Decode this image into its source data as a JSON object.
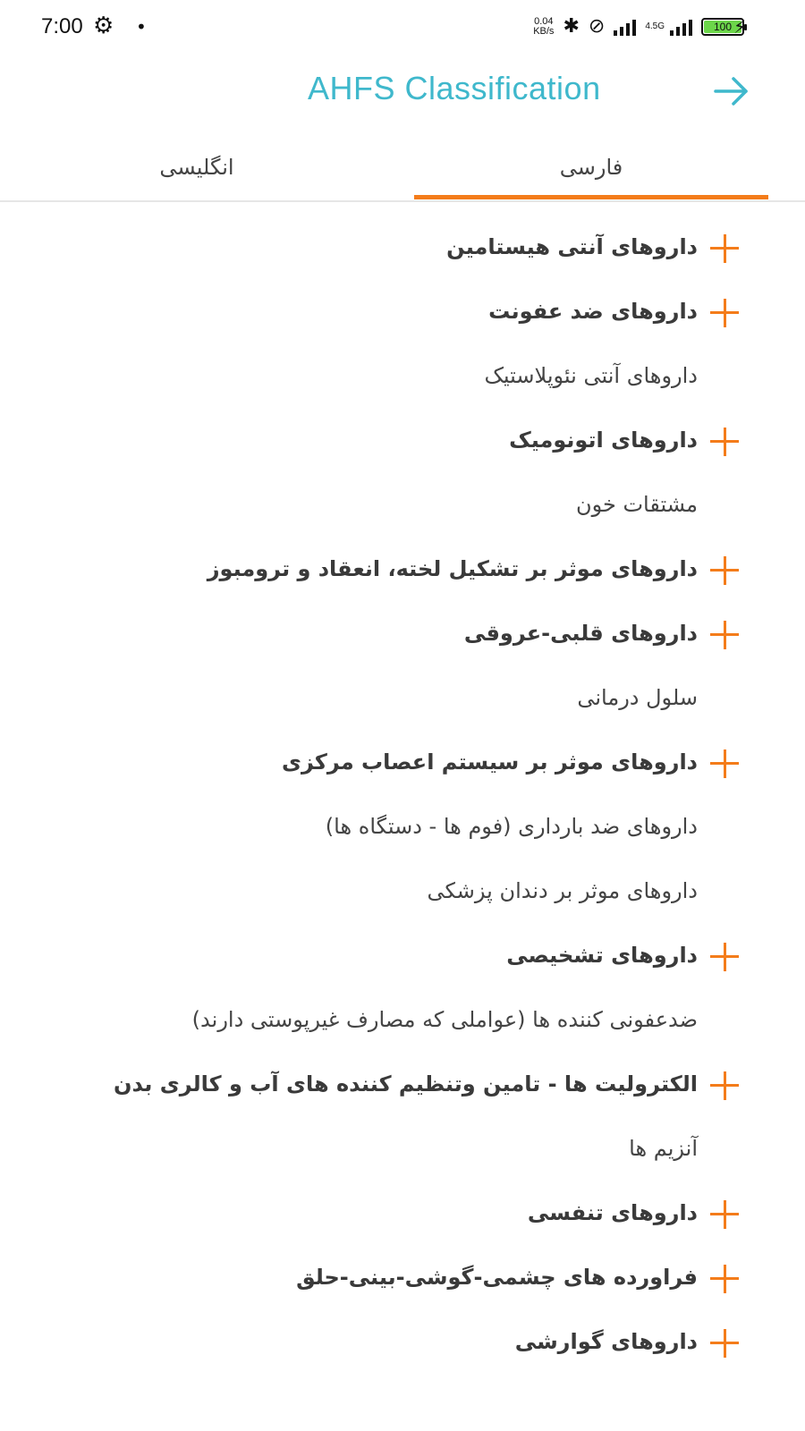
{
  "status_bar": {
    "time": "7:00",
    "speed_value": "0.04",
    "speed_unit": "KB/s",
    "network": "4.5G",
    "battery": "100"
  },
  "header": {
    "title": "AHFS Classification"
  },
  "tabs": [
    {
      "label": "انگلیسی",
      "active": false
    },
    {
      "label": "فارسی",
      "active": true
    }
  ],
  "accent_color": "#f47c1a",
  "title_color": "#3fb8cc",
  "items": [
    {
      "label": "داروهای آنتی هیستامین",
      "expandable": true
    },
    {
      "label": "داروهای ضد عفونت",
      "expandable": true
    },
    {
      "label": "داروهای آنتی نئوپلاستیک",
      "expandable": false
    },
    {
      "label": "داروهای اتونومیک",
      "expandable": true
    },
    {
      "label": "مشتقات خون",
      "expandable": false
    },
    {
      "label": "داروهای موثر بر تشکیل لخته، انعقاد و ترومبوز",
      "expandable": true
    },
    {
      "label": "داروهای قلبی-عروقی",
      "expandable": true
    },
    {
      "label": "سلول درمانی",
      "expandable": false
    },
    {
      "label": "داروهای موثر بر سیستم اعصاب مرکزی",
      "expandable": true
    },
    {
      "label": "داروهای ضد بارداری (فوم ها - دستگاه ها)",
      "expandable": false
    },
    {
      "label": "داروهای موثر بر دندان پزشکی",
      "expandable": false
    },
    {
      "label": "داروهای تشخیصی",
      "expandable": true
    },
    {
      "label": "ضدعفونی کننده ها (عواملی که مصارف غیرپوستی دارند)",
      "expandable": false
    },
    {
      "label": "الکترولیت ها - تامین وتنظیم کننده های آب و کالری بدن",
      "expandable": true
    },
    {
      "label": "آنزیم ها",
      "expandable": false
    },
    {
      "label": "داروهای تنفسی",
      "expandable": true
    },
    {
      "label": "فراورده های چشمی-گوشی-بینی-حلق",
      "expandable": true
    },
    {
      "label": "داروهای گوارشی",
      "expandable": true
    }
  ]
}
